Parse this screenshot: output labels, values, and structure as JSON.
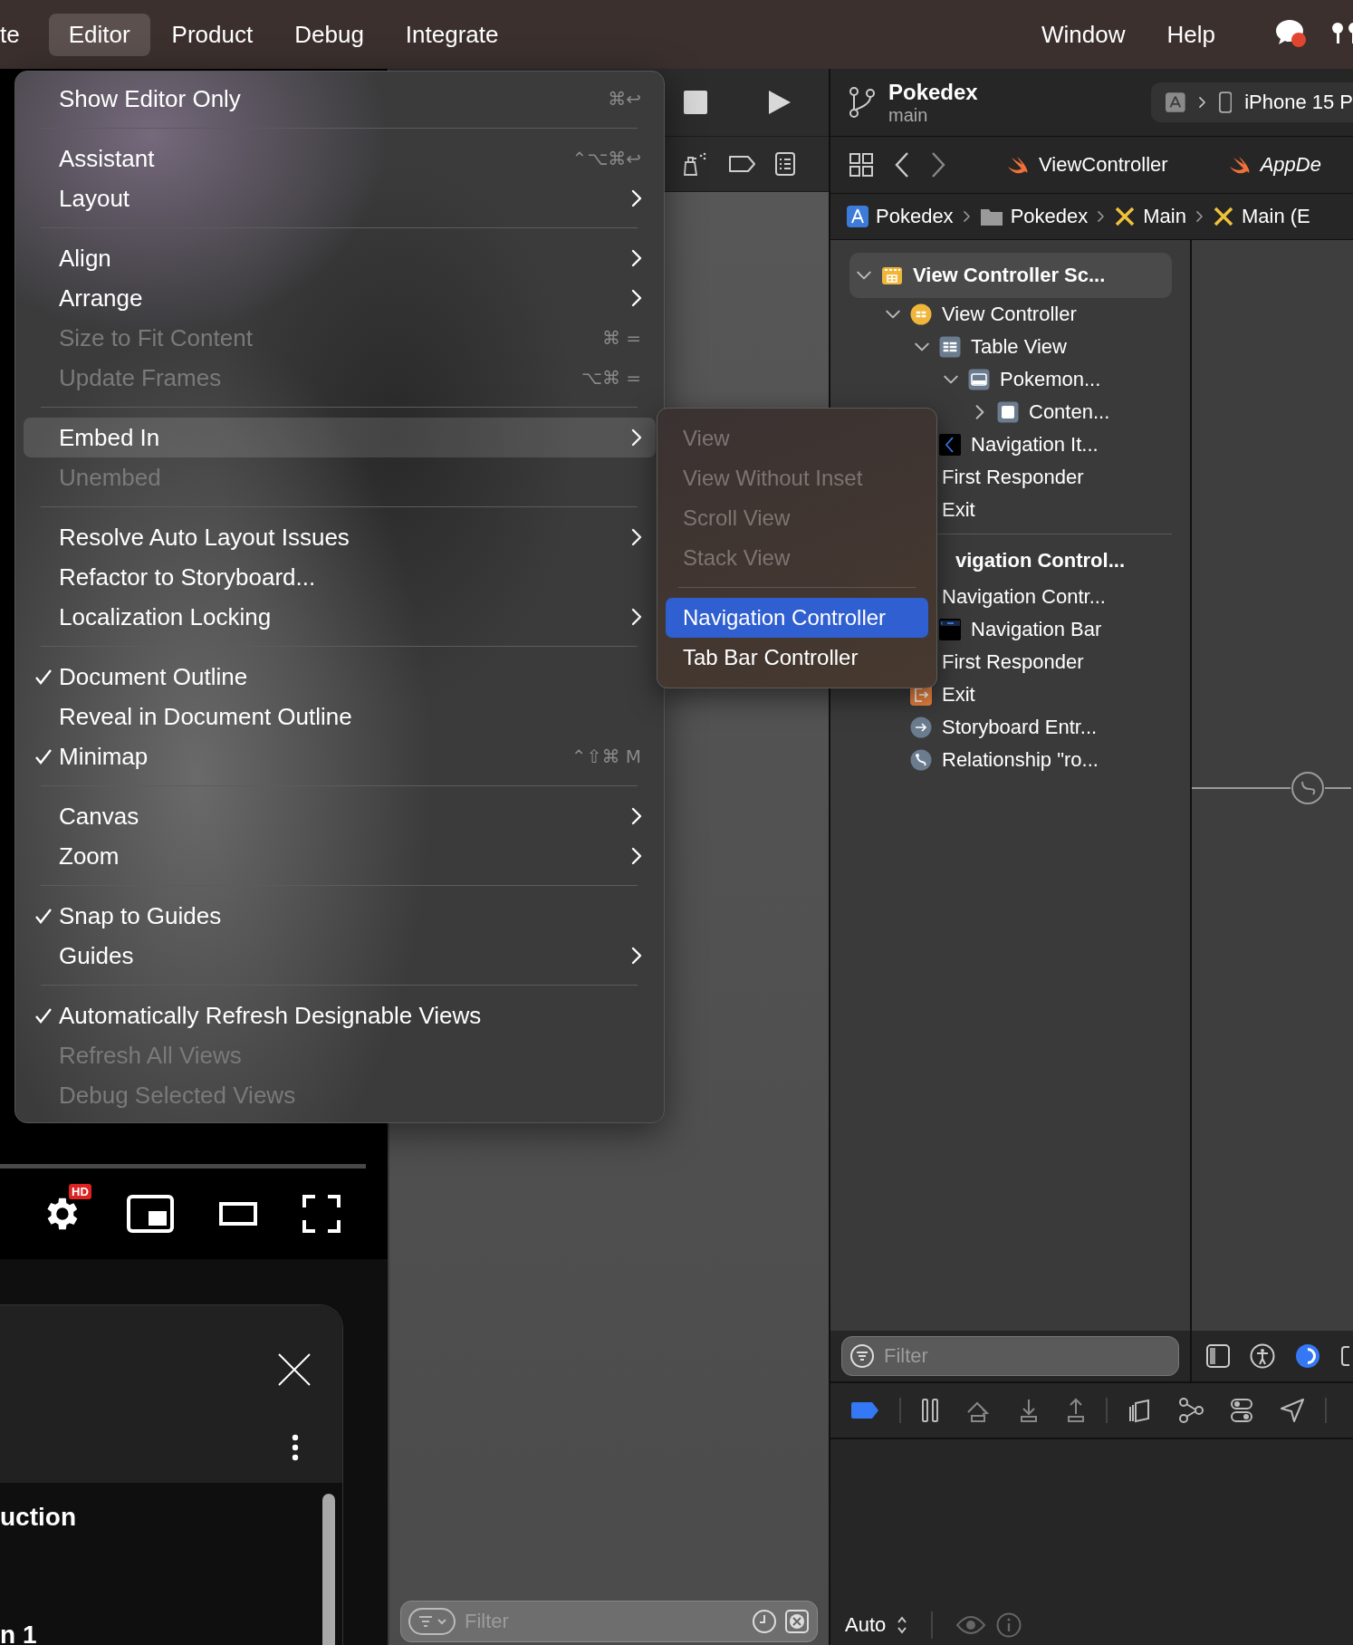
{
  "menu_bar": {
    "left_menus": [
      {
        "label": "te",
        "selected": false
      },
      {
        "label": "Editor",
        "selected": true
      },
      {
        "label": "Product",
        "selected": false
      },
      {
        "label": "Debug",
        "selected": false
      },
      {
        "label": "Integrate",
        "selected": false
      }
    ],
    "right_menus": [
      {
        "label": "Window",
        "selected": false
      },
      {
        "label": "Help",
        "selected": false
      }
    ]
  },
  "editor_menu": {
    "groups": [
      [
        {
          "label": "Show Editor Only",
          "shortcut": "⌘↩",
          "submenu": false,
          "disabled": false,
          "checked": false,
          "selected": false
        }
      ],
      [
        {
          "label": "Assistant",
          "shortcut": "⌃⌥⌘↩",
          "submenu": false,
          "disabled": false,
          "checked": false,
          "selected": false
        },
        {
          "label": "Layout",
          "submenu": true,
          "disabled": false,
          "checked": false,
          "selected": false
        }
      ],
      [
        {
          "label": "Align",
          "submenu": true,
          "disabled": false,
          "checked": false,
          "selected": false
        },
        {
          "label": "Arrange",
          "submenu": true,
          "disabled": false,
          "checked": false,
          "selected": false
        },
        {
          "label": "Size to Fit Content",
          "shortcut": "⌘ =",
          "submenu": false,
          "disabled": true,
          "checked": false,
          "selected": false
        },
        {
          "label": "Update Frames",
          "shortcut": "⌥⌘ =",
          "submenu": false,
          "disabled": true,
          "checked": false,
          "selected": false
        }
      ],
      [
        {
          "label": "Embed In",
          "submenu": true,
          "disabled": false,
          "checked": false,
          "selected": true
        },
        {
          "label": "Unembed",
          "submenu": false,
          "disabled": true,
          "checked": false,
          "selected": false
        }
      ],
      [
        {
          "label": "Resolve Auto Layout Issues",
          "submenu": true,
          "disabled": false,
          "checked": false,
          "selected": false
        },
        {
          "label": "Refactor to Storyboard...",
          "submenu": false,
          "disabled": false,
          "checked": false,
          "selected": false
        },
        {
          "label": "Localization Locking",
          "submenu": true,
          "disabled": false,
          "checked": false,
          "selected": false
        }
      ],
      [
        {
          "label": "Document Outline",
          "submenu": false,
          "disabled": false,
          "checked": true,
          "selected": false
        },
        {
          "label": "Reveal in Document Outline",
          "submenu": false,
          "disabled": false,
          "checked": false,
          "selected": false
        },
        {
          "label": "Minimap",
          "shortcut": "⌃⇧⌘ M",
          "submenu": false,
          "disabled": false,
          "checked": true,
          "selected": false
        }
      ],
      [
        {
          "label": "Canvas",
          "submenu": true,
          "disabled": false,
          "checked": false,
          "selected": false
        },
        {
          "label": "Zoom",
          "submenu": true,
          "disabled": false,
          "checked": false,
          "selected": false
        }
      ],
      [
        {
          "label": "Snap to Guides",
          "submenu": false,
          "disabled": false,
          "checked": true,
          "selected": false
        },
        {
          "label": "Guides",
          "submenu": true,
          "disabled": false,
          "checked": false,
          "selected": false
        }
      ],
      [
        {
          "label": "Automatically Refresh Designable Views",
          "submenu": false,
          "disabled": false,
          "checked": true,
          "selected": false
        },
        {
          "label": "Refresh All Views",
          "submenu": false,
          "disabled": true,
          "checked": false,
          "selected": false
        },
        {
          "label": "Debug Selected Views",
          "submenu": false,
          "disabled": true,
          "checked": false,
          "selected": false
        }
      ]
    ]
  },
  "embed_submenu": {
    "groups": [
      [
        {
          "label": "View",
          "disabled": true,
          "selected": false
        },
        {
          "label": "View Without Inset",
          "disabled": true,
          "selected": false
        },
        {
          "label": "Scroll View",
          "disabled": true,
          "selected": false
        },
        {
          "label": "Stack View",
          "disabled": true,
          "selected": false
        }
      ],
      [
        {
          "label": "Navigation Controller",
          "disabled": false,
          "selected": true
        },
        {
          "label": "Tab Bar Controller",
          "disabled": false,
          "selected": false
        }
      ]
    ]
  },
  "video_player": {
    "badge": "HD"
  },
  "playlist": {
    "items": [
      {
        "label": "uction",
        "kind": "title"
      },
      {
        "label": "n 1",
        "kind": "subtitle"
      }
    ]
  },
  "library_panel": {
    "filter": {
      "placeholder": "Filter"
    }
  },
  "project": {
    "name": "Pokedex",
    "branch": "main",
    "device": "iPhone 15 P"
  },
  "tabs": [
    {
      "label": "ViewController",
      "preview": false
    },
    {
      "label": "AppDe",
      "preview": true
    }
  ],
  "breadcrumb": [
    {
      "label": "Pokedex",
      "kind": "project"
    },
    {
      "label": "Pokedex",
      "kind": "folder"
    },
    {
      "label": "Main",
      "kind": "storyboard"
    },
    {
      "label": "Main (E",
      "kind": "storyboard"
    }
  ],
  "outline": [
    {
      "label": "View Controller Sc...",
      "kind": "scene",
      "expanded": true,
      "selected": true,
      "children": [
        {
          "label": "View Controller",
          "kind": "controller",
          "expanded": true,
          "selected": false,
          "children": [
            {
              "label": "Table View",
              "kind": "table",
              "expanded": true,
              "selected": false,
              "children": [
                {
                  "label": "Pokemon...",
                  "kind": "cell",
                  "expanded": true,
                  "selected": false,
                  "children": [
                    {
                      "label": "Conten...",
                      "kind": "content",
                      "expanded": false,
                      "selected": false
                    }
                  ]
                }
              ]
            },
            {
              "label": "Navigation It...",
              "kind": "navitem",
              "selected": false
            }
          ]
        },
        {
          "label": "First Responder",
          "selected": false
        },
        {
          "label": "Exit",
          "selected": false
        }
      ]
    },
    {
      "label": "vigation Control...",
      "kind": "scene",
      "selected": false,
      "children": [
        {
          "label": "Navigation Contr...",
          "selected": false,
          "children": [
            {
              "label": "Navigation Bar",
              "kind": "navbar",
              "selected": false
            }
          ]
        },
        {
          "label": "First Responder",
          "selected": false
        },
        {
          "label": "Exit",
          "kind": "exit",
          "selected": false
        },
        {
          "label": "Storyboard Entr...",
          "kind": "entry",
          "selected": false
        },
        {
          "label": "Relationship \"ro...",
          "kind": "relationship",
          "selected": false
        }
      ]
    }
  ],
  "outline_filter": {
    "placeholder": "Filter"
  },
  "inspector": {
    "appearance": "Auto"
  }
}
